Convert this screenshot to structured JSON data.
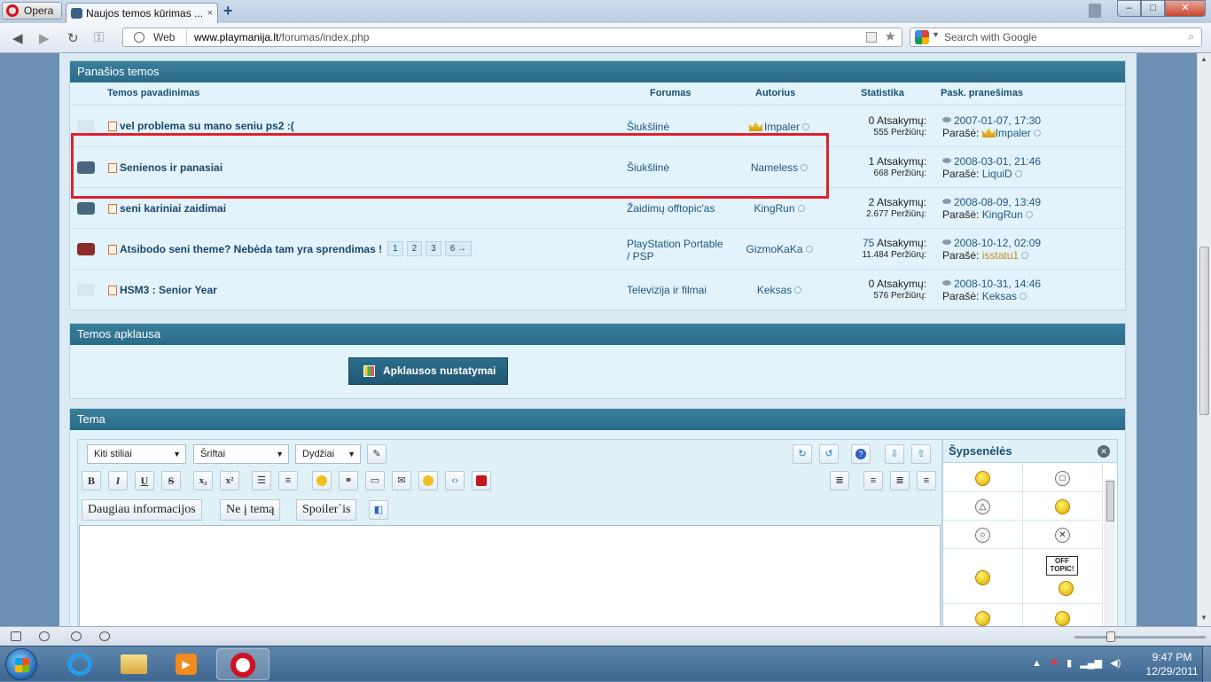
{
  "browser": {
    "menu_label": "Opera",
    "tab_title": "Naujos temos kūrimas ...",
    "tab_close": "×",
    "new_tab": "+",
    "web_badge": "Web",
    "url_host": "www.playmanija.lt",
    "url_path": "/forumas/index.php",
    "search_placeholder": "Search with Google",
    "win_min": "–",
    "win_max": "□",
    "win_close": "✕"
  },
  "similar": {
    "header": "Panašios temos",
    "columns": {
      "title": "Temos pavadinimas",
      "forum": "Forumas",
      "author": "Autorius",
      "stats": "Statistika",
      "last": "Pask. pranešimas"
    },
    "rows": [
      {
        "icon": "light",
        "title": "vel problema su mano seniu ps2 :(",
        "forum": "Šiukšlinė",
        "author": "Impaler",
        "author_crown": true,
        "replies": "0",
        "replies_label": "Atsakymų:",
        "views": "555 Peržiūrų:",
        "last_date": "2007-01-07, 17:30",
        "posted_by_label": "Parašė:",
        "last_user": "Impaler",
        "last_crown": true,
        "last_user_color": "blue"
      },
      {
        "icon": "dark",
        "title": "Senienos ir panasiai",
        "forum": "Šiukšlinė",
        "author": "Nameless",
        "author_crown": false,
        "replies": "1",
        "replies_label": "Atsakymų:",
        "views": "668 Peržiūrų:",
        "last_date": "2008-03-01, 21:46",
        "posted_by_label": "Parašė:",
        "last_user": "LiquiD",
        "last_crown": false,
        "last_user_color": "blue"
      },
      {
        "icon": "dark",
        "title": "seni kariniai zaidimai",
        "forum": "Žaidimų offtopic'as",
        "author": "KingRun",
        "author_crown": false,
        "replies": "2",
        "replies_label": "Atsakymų:",
        "views": "2.677 Peržiūrų:",
        "last_date": "2008-08-09, 13:49",
        "posted_by_label": "Parašė:",
        "last_user": "KingRun",
        "last_crown": false,
        "last_user_color": "blue"
      },
      {
        "icon": "red",
        "title": "Atsibodo seni theme? Nebėda tam yra sprendimas !",
        "pages": [
          "1",
          "2",
          "3",
          "6 →"
        ],
        "forum": "PlayStation Portable / PSP",
        "author": "GizmoKaKa",
        "author_crown": false,
        "replies": "75",
        "replies_label": "Atsakymų:",
        "views": "11.484 Peržiūrų:",
        "last_date": "2008-10-12, 02:09",
        "posted_by_label": "Parašė:",
        "last_user": "isstatu1",
        "last_crown": false,
        "last_user_color": "orange"
      },
      {
        "icon": "light",
        "title": "HSM3 : Senior Year",
        "forum": "Televizija ir filmai",
        "author": "Keksas",
        "author_crown": false,
        "replies": "0",
        "replies_label": "Atsakymų:",
        "views": "576 Peržiūrų:",
        "last_date": "2008-10-31, 14:46",
        "posted_by_label": "Parašė:",
        "last_user": "Keksas",
        "last_crown": false,
        "last_user_color": "blue"
      }
    ]
  },
  "poll": {
    "header": "Temos apklausa",
    "button": "Apklausos nustatymai"
  },
  "topic": {
    "header": "Tema",
    "select_styles": "Kiti stiliai",
    "select_fonts": "Šriftai",
    "select_sizes": "Dydžiai",
    "fmt": {
      "bold": "B",
      "italic": "I",
      "underline": "U",
      "strike": "S",
      "sub": "x₂",
      "sup": "x²"
    },
    "btn_more_info": "Daugiau informacijos",
    "btn_offtopic": "Ne į temą",
    "btn_spoiler": "Spoiler`is",
    "smiles_title": "Šypsenėlės",
    "smile_close": "✕",
    "sign_text": "OFF TOPIC!",
    "ps_circle": "○",
    "ps_triangle": "△",
    "ps_square": "□",
    "ps_cross": "✕"
  },
  "taskbar": {
    "time": "9:47 PM",
    "date": "12/29/2011"
  }
}
